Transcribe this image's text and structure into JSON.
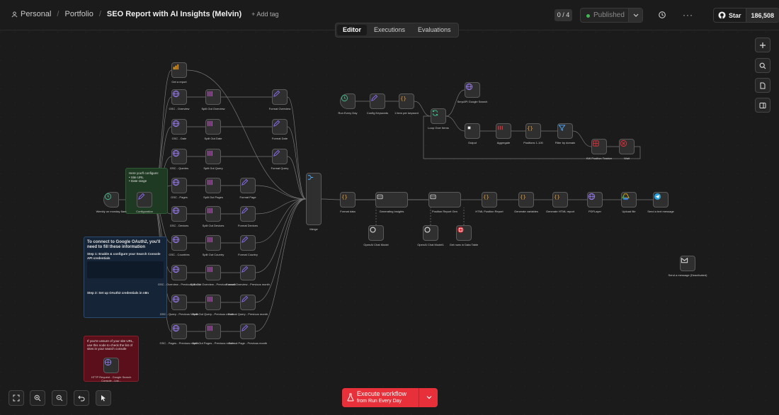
{
  "breadcrumbs": {
    "workspace": "Personal",
    "folder": "Portfolio",
    "title": "SEO Report with AI Insights (Melvin)",
    "add_tag": "+ Add tag"
  },
  "header": {
    "counter": "0 / 4",
    "publish_label": "Published",
    "github_star": "Star",
    "github_count": "186,508"
  },
  "tabs": [
    "Editor",
    "Executions",
    "Evaluations"
  ],
  "colors": {
    "accent": "#e8303a",
    "published_dot": "#3fb950",
    "sticky_green": "#1f3a22",
    "sticky_blue": "#152436",
    "sticky_red": "#5a0f1a"
  },
  "nodes": {
    "get_a_report": "Get a report",
    "gsc_overview": "GSC - Overview",
    "split_overview": "Split Out Overview",
    "format_overview": "Format Overview",
    "gsc_date": "GSC - Date",
    "split_date": "Split Out Date",
    "format_date": "Format Date",
    "gsc_queries": "GSC - Queries",
    "split_query": "Split Out Query",
    "format_query": "Format Query",
    "weekly_trigger": "Weekly on monday 8am",
    "configuration": "Configuration",
    "gsc_pages": "GSC - Pages",
    "split_pages": "Split Out Pages",
    "format_page": "Format Page",
    "gsc_devices": "GSC - Devices",
    "split_devices": "Split Out Devices",
    "format_devices": "Format Devices",
    "gsc_countries": "GSC - Countries",
    "split_country": "Split Out Country",
    "format_country": "Format Country",
    "gsc_overview_prev": "GSC - Overview - Previous Month",
    "split_overview_prev": "Split Out Overview - Previous month",
    "format_overview_prev": "Format Overview - Previous month",
    "gsc_query_prev": "GSC - Query - Previous Month",
    "split_query_prev": "Split Out Query - Previous month",
    "format_query_prev": "Format Query - Previous month",
    "gsc_pages_prev": "GSC - Pages - Previous month",
    "split_pages_prev": "Split Out Pages - Previous month",
    "format_page_prev": "Format Page - Previous month",
    "merge": "Merge",
    "format_data": "Format data",
    "generating_insights": "Generating Insights",
    "openai_chat_1": "OpenAI Chat Model",
    "position_report_gen": "Position Report Gen",
    "openai_chat_2": "OpenAI Chat Model1",
    "get_rows": "Get rows in Data Table",
    "html_position_report": "HTML Position Report",
    "generate_variables": "Generate variables",
    "generate_html_report": "Generate HTML report",
    "pdflayer": "PDFLayer",
    "upload_file": "Upload file",
    "send_text": "Send a text message",
    "run_every_day": "Run Every Day",
    "config_keywords": "Config Keywords",
    "item_per_keyword": "1 item per keyword",
    "loop_over_items": "Loop Over Items",
    "serpapi": "SerpAPI Google Search",
    "output": "Output",
    "aggregate": "Aggregate",
    "position_top100": "Positions 1-100",
    "filter_domain": "Filter by domain",
    "kw_tracker": "KW Position Tracker",
    "wait": "Wait",
    "send_message": "Send a message (Deactivated)"
  },
  "stickies": {
    "green_title": "Here you'll configure:",
    "green_items": [
      "Site URL",
      "Date range"
    ],
    "blue_title": "To connect to Google OAuth2, you'll need to fill these information",
    "blue_step1": "Step 1: Enable & configure your Search Console API credentials",
    "blue_step2": "Step 2: Set up OAuth2 credentials in n8n",
    "red_text": "If you're unsure of your site URL, use this node to check the list of sites in your search console",
    "red_node": "HTTP Request - Google Search Console - List..."
  },
  "execute": {
    "label": "Execute workflow",
    "sub": "from Run Every Day"
  }
}
